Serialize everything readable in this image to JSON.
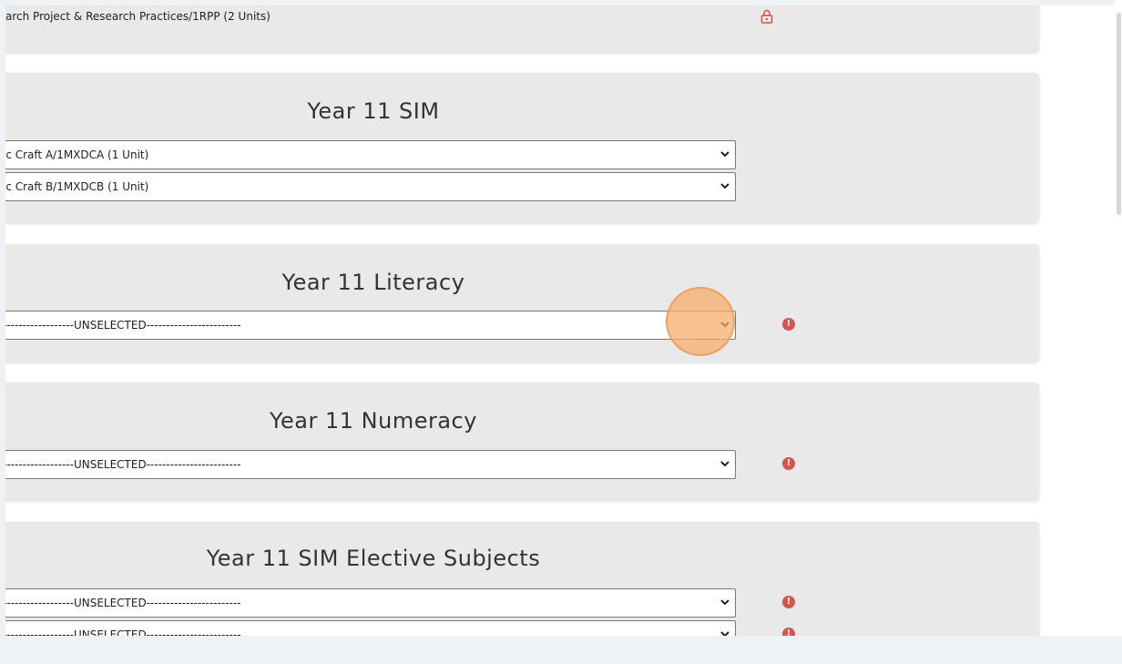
{
  "top_item": {
    "label": "arch Project & Research Practices/1RPP (2 Units)",
    "icon": "lock-icon",
    "icon_color": "#d9534f"
  },
  "sections": [
    {
      "title": "Year 11 SIM",
      "selects": [
        {
          "value": "ic Craft A/1MXDCA (1 Unit)"
        },
        {
          "value": "ic Craft B/1MXDCB (1 Unit)"
        }
      ]
    },
    {
      "title": "Year 11 Literacy",
      "selects": [
        {
          "value": "------------------UNSELECTED------------------------"
        }
      ]
    },
    {
      "title": "Year 11 Numeracy",
      "selects": [
        {
          "value": "------------------UNSELECTED------------------------"
        }
      ]
    },
    {
      "title": "Year 11 SIM Elective Subjects",
      "selects": [
        {
          "value": "------------------UNSELECTED------------------------"
        },
        {
          "value": "------------------UNSELECTED------------------------"
        }
      ]
    }
  ],
  "alert_icon_glyph": "!",
  "colors": {
    "card_bg": "#e9e9e9",
    "alert": "#d9534f",
    "click_indicator": "#f7ab67"
  }
}
